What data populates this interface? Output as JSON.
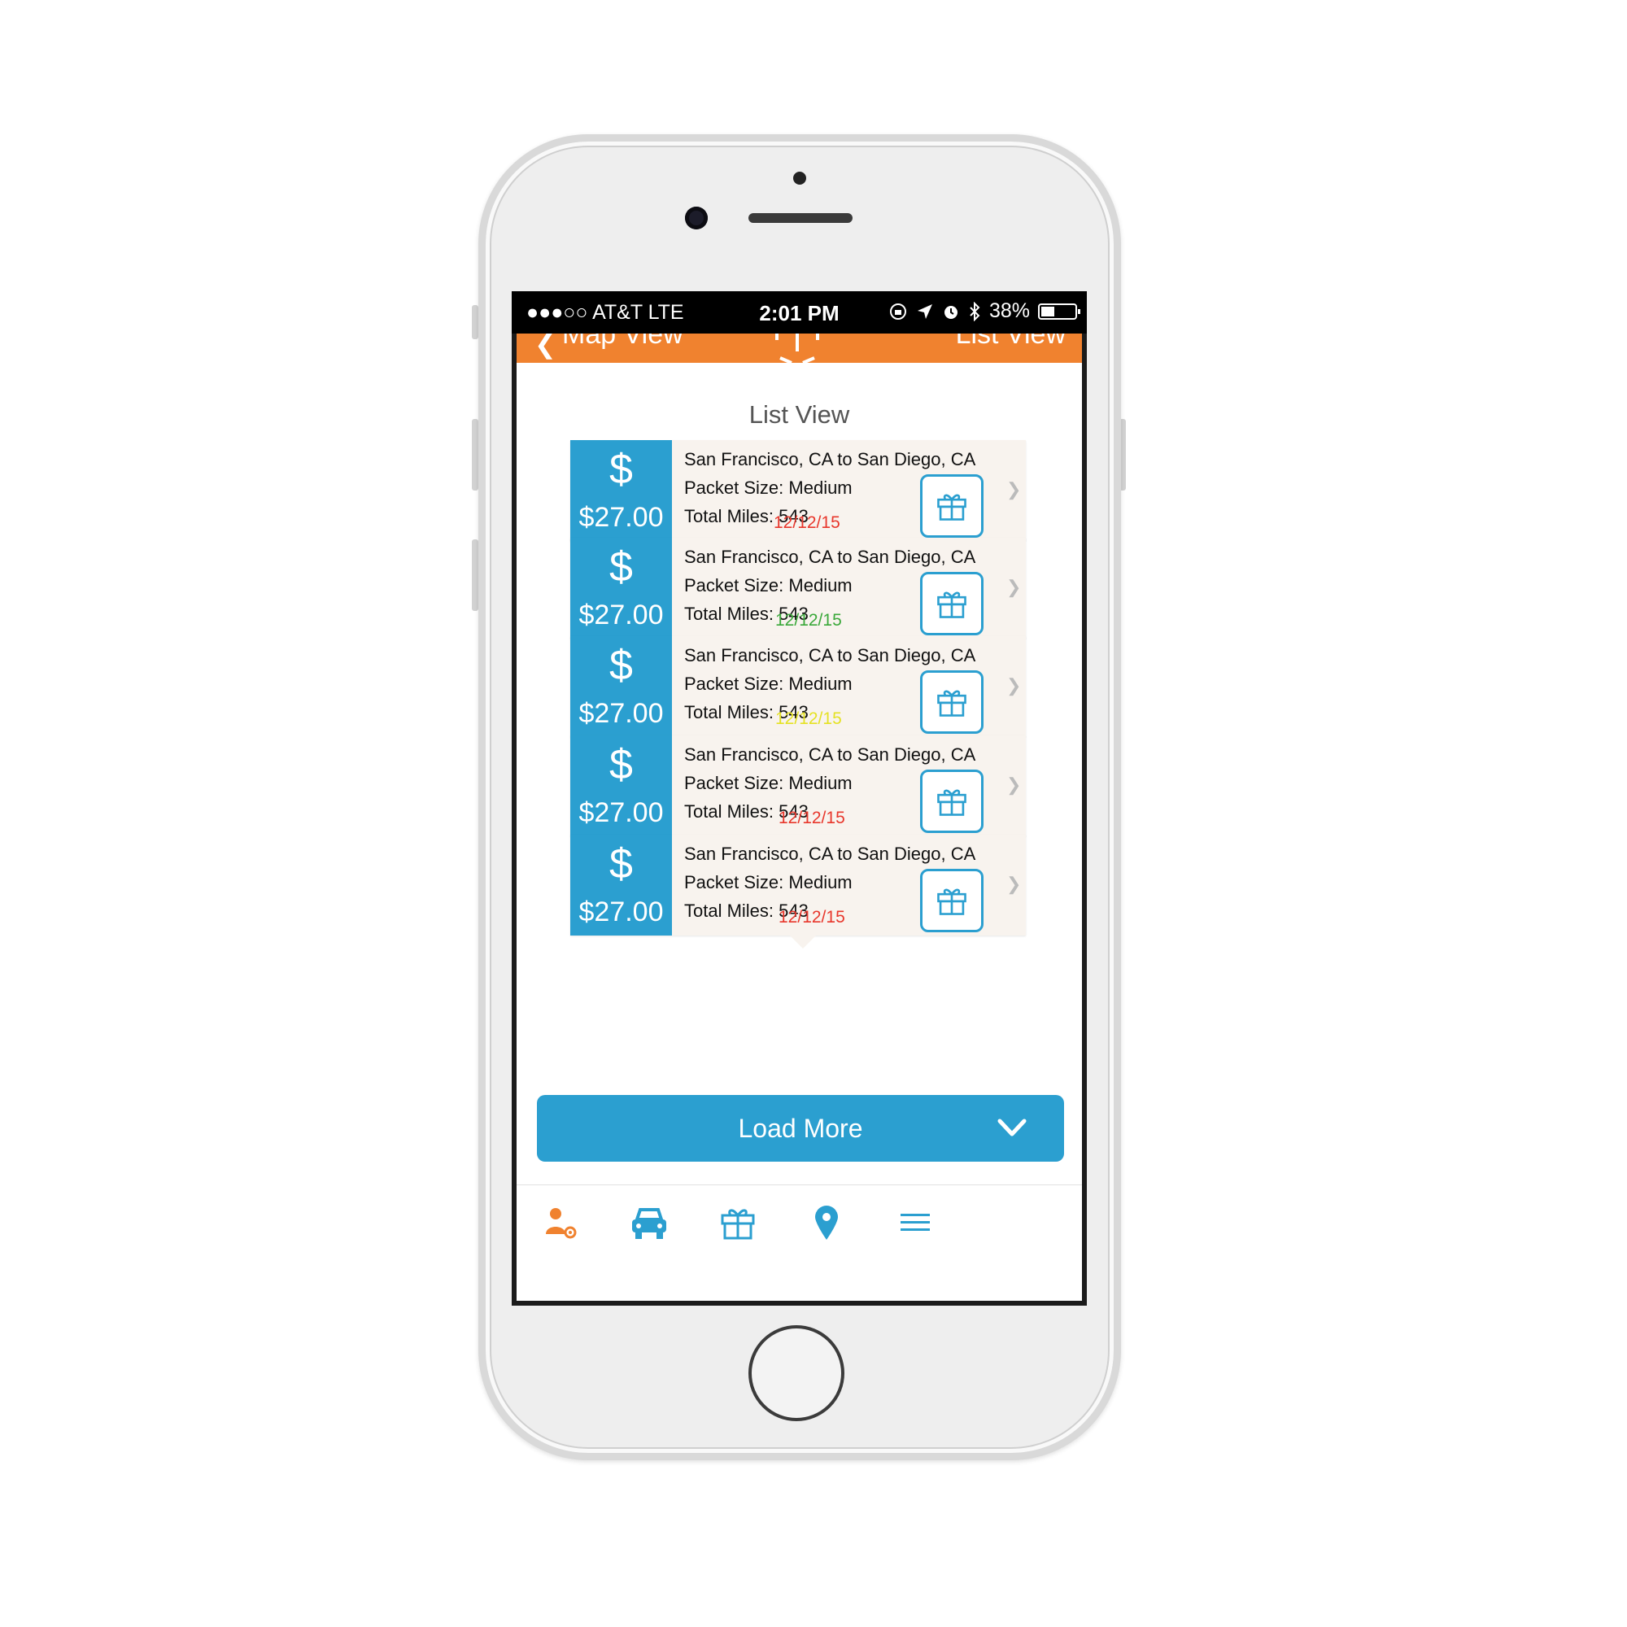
{
  "status_bar": {
    "carrier": "●●●○○ AT&T  LTE",
    "time": "2:01 PM",
    "battery": "38%"
  },
  "top_bar": {
    "left_label": "Map View",
    "right_label": "List View"
  },
  "page": {
    "title": "List View"
  },
  "cards": [
    {
      "price": "$27.00",
      "route": "San Francisco, CA to San Diego, CA",
      "packet": "Packet Size: Medium",
      "miles": "Total Miles: 543",
      "date": "12/12/15",
      "date_color": "#e8372c"
    },
    {
      "price": "$27.00",
      "route": "San Francisco, CA to San Diego, CA",
      "packet": "Packet Size: Medium",
      "miles": "Total Miles: 543",
      "date": "12/12/15",
      "date_color": "#3aa83a"
    },
    {
      "price": "$27.00",
      "route": "San Francisco, CA to San Diego, CA",
      "packet": "Packet Size: Medium",
      "miles": "Total Miles: 543",
      "date": "12/12/15",
      "date_color": "#e5e224"
    },
    {
      "price": "$27.00",
      "route": "San Francisco, CA to San Diego, CA",
      "packet": "Packet Size: Medium",
      "miles": "Total Miles: 543",
      "date": "12/12/15",
      "date_color": "#e8372c"
    },
    {
      "price": "$27.00",
      "route": "San Francisco, CA to San Diego, CA",
      "packet": "Packet Size: Medium",
      "miles": "Total Miles: 543",
      "date": "12/12/15",
      "date_color": "#e8372c"
    }
  ],
  "load_more": {
    "label": "Load More"
  },
  "tabs": [
    {
      "icon": "user-settings-icon",
      "color": "#f0822f"
    },
    {
      "icon": "car-icon",
      "color": "#2b9fd0"
    },
    {
      "icon": "gift-icon",
      "color": "#2b9fd0"
    },
    {
      "icon": "location-pin-icon",
      "color": "#2b9fd0"
    },
    {
      "icon": "menu-icon",
      "color": "#2b9fd0"
    }
  ],
  "colors": {
    "accent_blue": "#2b9fd0",
    "accent_orange": "#f0822f"
  }
}
